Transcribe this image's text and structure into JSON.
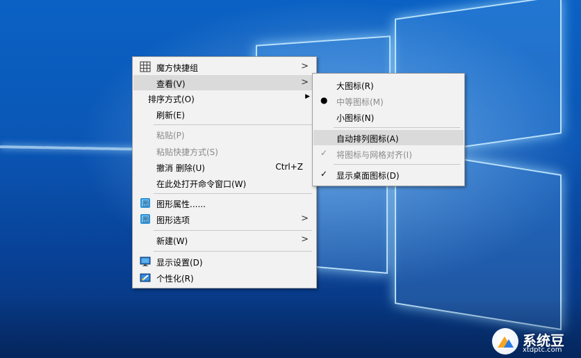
{
  "main_menu": {
    "items": [
      {
        "label": "魔方快捷组",
        "icon": "grid-icon"
      },
      {
        "label": "查看(V)"
      },
      {
        "label": "排序方式(O)"
      },
      {
        "label": "刷新(E)"
      },
      {
        "label": "粘贴(P)"
      },
      {
        "label": "粘贴快捷方式(S)"
      },
      {
        "label": "撤消 删除(U)",
        "shortcut": "Ctrl+Z"
      },
      {
        "label": "在此处打开命令窗口(W)"
      },
      {
        "label": "图形属性......",
        "icon": "graphics-icon"
      },
      {
        "label": "图形选项",
        "icon": "graphics-icon"
      },
      {
        "label": "新建(W)"
      },
      {
        "label": "显示设置(D)",
        "icon": "monitor-icon"
      },
      {
        "label": "个性化(R)",
        "icon": "personalize-icon"
      }
    ]
  },
  "view_submenu": {
    "items": [
      {
        "label": "大图标(R)"
      },
      {
        "label": "中等图标(M)",
        "mark": "●"
      },
      {
        "label": "小图标(N)"
      },
      {
        "label": "自动排列图标(A)"
      },
      {
        "label": "将图标与网格对齐(I)",
        "mark": "✓"
      },
      {
        "label": "显示桌面图标(D)",
        "mark": "✓"
      }
    ]
  },
  "watermark": {
    "brand": "系统豆",
    "site": "xtdptc.com"
  },
  "colors": {
    "desktop": "#0a56b5",
    "menu_bg": "#f2f2f2",
    "highlight": "#dadada",
    "disabled_text": "#8a8a8a"
  }
}
